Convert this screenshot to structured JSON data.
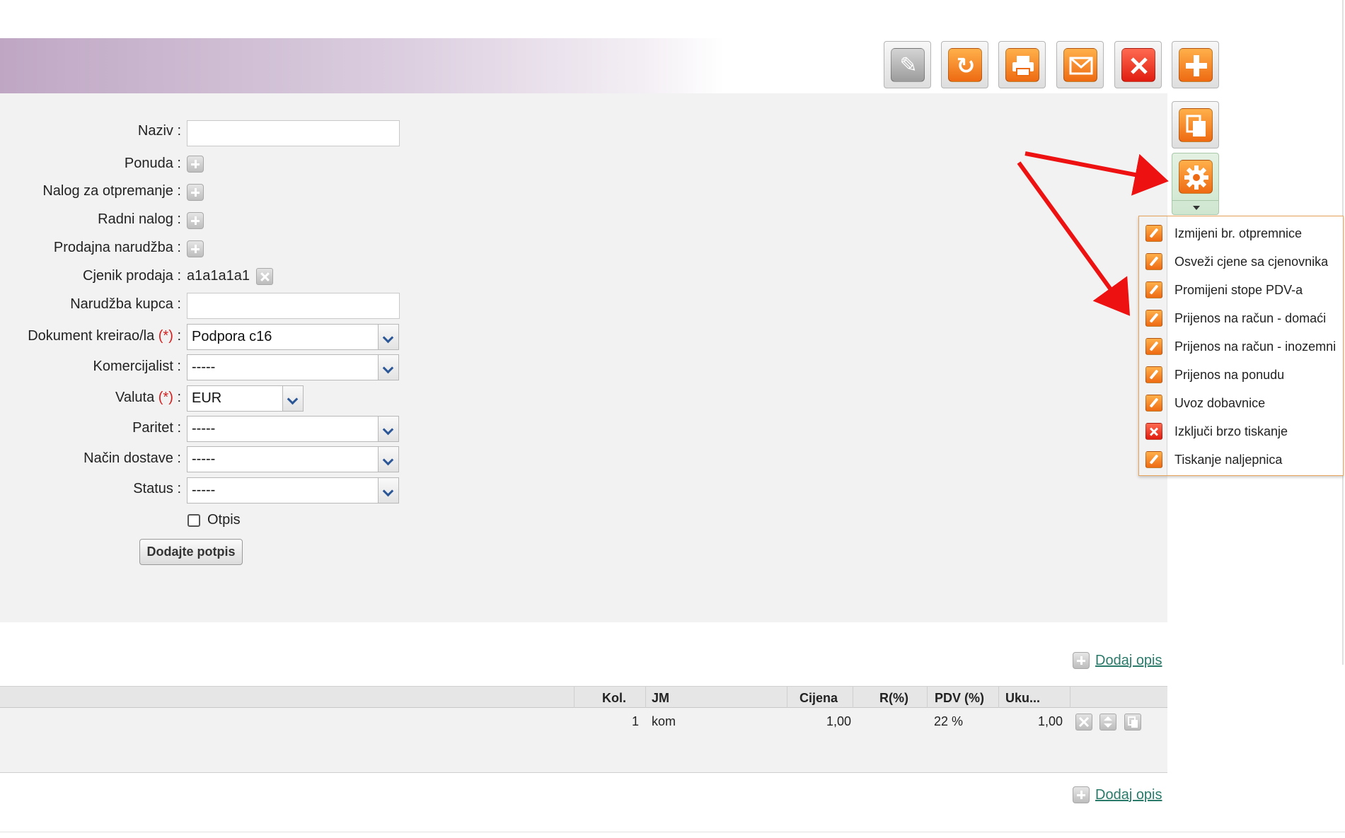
{
  "form": {
    "naziv_label": "Naziv :",
    "naziv_value": "",
    "ponuda_label": "Ponuda :",
    "nalog_label": "Nalog za otpremanje :",
    "radni_label": "Radni nalog :",
    "prodajna_label": "Prodajna narudžba :",
    "cjenik_label": "Cjenik prodaja :",
    "cjenik_value": "a1a1a1a1",
    "narudzba_label": "Narudžba kupca :",
    "narudzba_value": "",
    "dokument_label": "Dokument kreirao/la",
    "required_mark": "(*)",
    "colon": ":",
    "dokument_value": "Podpora c16",
    "komercijalist_label": "Komercijalist :",
    "komercijalist_value": "-----",
    "valuta_label": "Valuta",
    "valuta_value": "EUR",
    "paritet_label": "Paritet :",
    "paritet_value": "-----",
    "nacin_label": "Način dostave :",
    "nacin_value": "-----",
    "status_label": "Status :",
    "status_value": "-----",
    "otpis_label": "Otpis",
    "otpis_checked": false,
    "signature_button": "Dodajte potpis"
  },
  "toolbar": {
    "buttons": [
      {
        "name": "edit",
        "icon": "pencil-icon"
      },
      {
        "name": "refresh",
        "icon": "refresh-icon"
      },
      {
        "name": "print",
        "icon": "printer-icon"
      },
      {
        "name": "email",
        "icon": "envelope-icon"
      },
      {
        "name": "delete",
        "icon": "close-icon"
      },
      {
        "name": "add",
        "icon": "plus-icon"
      },
      {
        "name": "copy",
        "icon": "copy-icon"
      },
      {
        "name": "settings",
        "icon": "gear-icon"
      }
    ]
  },
  "menu": {
    "items": [
      {
        "label": "Izmijeni br. otpremnice",
        "icon": "pencil-icon"
      },
      {
        "label": "Osveži cjene sa cjenovnika",
        "icon": "pencil-icon"
      },
      {
        "label": "Promijeni stope PDV-a",
        "icon": "pencil-icon"
      },
      {
        "label": "Prijenos na račun - domaći",
        "icon": "pencil-icon"
      },
      {
        "label": "Prijenos na račun - inozemni",
        "icon": "pencil-icon"
      },
      {
        "label": "Prijenos na ponudu",
        "icon": "pencil-icon"
      },
      {
        "label": "Uvoz dobavnice",
        "icon": "pencil-icon"
      },
      {
        "label": "Izključi brzo tiskanje",
        "icon": "close-icon"
      },
      {
        "label": "Tiskanje naljepnica",
        "icon": "pencil-icon"
      }
    ]
  },
  "add_description_link": "Dodaj opis",
  "table": {
    "headers": {
      "kol": "Kol.",
      "jm": "JM",
      "cijena": "Cijena",
      "r": "R(%)",
      "pdv": "PDV (%)",
      "ukupno": "Uku..."
    },
    "rows": [
      {
        "kol": "1",
        "jm": "kom",
        "cijena": "1,00",
        "r": "",
        "pdv": "22 %",
        "ukupno": "1,00"
      }
    ]
  },
  "colors": {
    "accent_orange": "#ee6a12",
    "header_purple": "#bfa7c4",
    "link_green": "#2a7a6a",
    "annotation_red": "#ee1111"
  }
}
